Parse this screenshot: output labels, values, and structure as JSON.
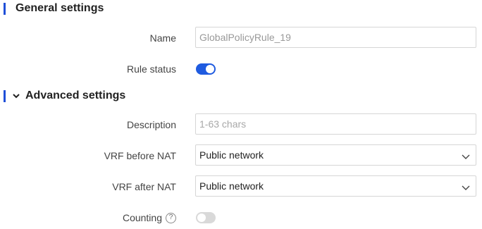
{
  "general": {
    "title": "General settings",
    "name_label": "Name",
    "name_value": "GlobalPolicyRule_19",
    "rule_status_label": "Rule status",
    "rule_status_on": true
  },
  "advanced": {
    "title": "Advanced settings",
    "expanded": true,
    "description_label": "Description",
    "description_placeholder": "1-63 chars",
    "vrf_before_label": "VRF before NAT",
    "vrf_before_value": "Public network",
    "vrf_after_label": "VRF after NAT",
    "vrf_after_value": "Public network",
    "counting_label": "Counting",
    "counting_help": "?",
    "counting_on": false
  },
  "colors": {
    "accent": "#1f5be0",
    "section_bar": "#1f4fd8",
    "toggle_off": "#d9d9d9"
  }
}
